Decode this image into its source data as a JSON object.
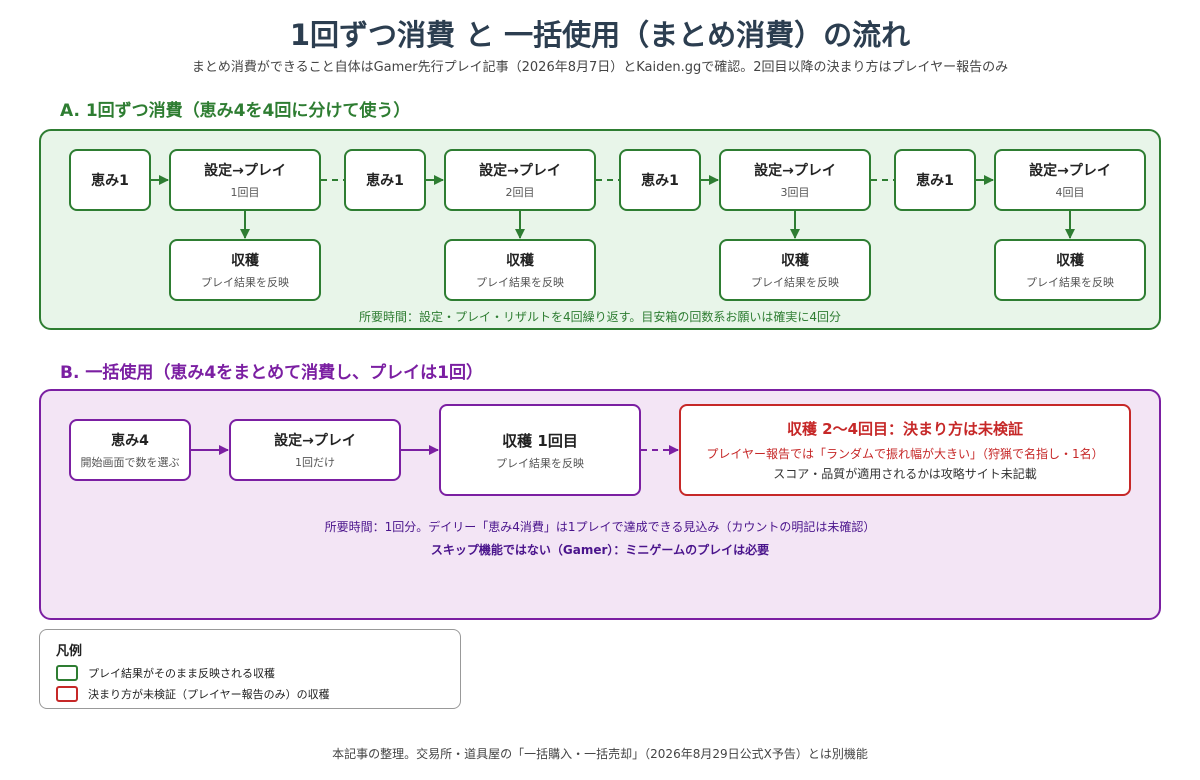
{
  "title": "1回ずつ消費 と 一括使用（まとめ消費）の流れ",
  "subtitle": "まとめ消費ができること自体はGamer先行プレイ記事（2026年8月7日）とKaiden.ggで確認。2回目以降の決まり方はプレイヤー報告のみ",
  "section_a": {
    "heading": "A. 1回ずつ消費（恵み4を4回に分けて使う）",
    "units": [
      {
        "blessing": "恵み1",
        "play_title": "設定→プレイ",
        "play_sub": "1回目",
        "harvest_title": "収穫",
        "harvest_sub": "プレイ結果を反映"
      },
      {
        "blessing": "恵み1",
        "play_title": "設定→プレイ",
        "play_sub": "2回目",
        "harvest_title": "収穫",
        "harvest_sub": "プレイ結果を反映"
      },
      {
        "blessing": "恵み1",
        "play_title": "設定→プレイ",
        "play_sub": "3回目",
        "harvest_title": "収穫",
        "harvest_sub": "プレイ結果を反映"
      },
      {
        "blessing": "恵み1",
        "play_title": "設定→プレイ",
        "play_sub": "4回目",
        "harvest_title": "収穫",
        "harvest_sub": "プレイ結果を反映"
      }
    ],
    "note": "所要時間：設定・プレイ・リザルトを4回繰り返す。目安箱の回数系お願いは確実に4回分"
  },
  "section_b": {
    "heading": "B. 一括使用（恵み4をまとめて消費し、プレイは1回）",
    "blessing_title": "恵み4",
    "blessing_sub": "開始画面で数を選ぶ",
    "play_title": "設定→プレイ",
    "play_sub": "1回だけ",
    "harvest_title": "収穫 1回目",
    "harvest_sub": "プレイ結果を反映",
    "unverified_title": "収穫 2〜4回目：決まり方は未検証",
    "unverified_line1": "プレイヤー報告では「ランダムで振れ幅が大きい」（狩猟で名指し・1名）",
    "unverified_line2": "スコア・品質が適用されるかは攻略サイト未記載",
    "note1": "所要時間：1回分。デイリー「恵み4消費」は1プレイで達成できる見込み（カウントの明記は未確認）",
    "note2": "スキップ機能ではない（Gamer）：ミニゲームのプレイは必要"
  },
  "legend": {
    "title": "凡例",
    "items": [
      {
        "label": "プレイ結果がそのまま反映される収穫",
        "color": "#2e7d32"
      },
      {
        "label": "決まり方が未検証（プレイヤー報告のみ）の収穫",
        "color": "#c62828"
      }
    ]
  },
  "footer": "本記事の整理。交易所・道具屋の「一括購入・一括売却」（2026年8月29日公式X予告）とは別機能",
  "colors": {
    "green": "#2e7d32",
    "purple": "#7b1fa2",
    "red": "#c62828",
    "panel_a_bg": "#e8f5e9",
    "panel_b_bg": "#f3e5f5"
  }
}
